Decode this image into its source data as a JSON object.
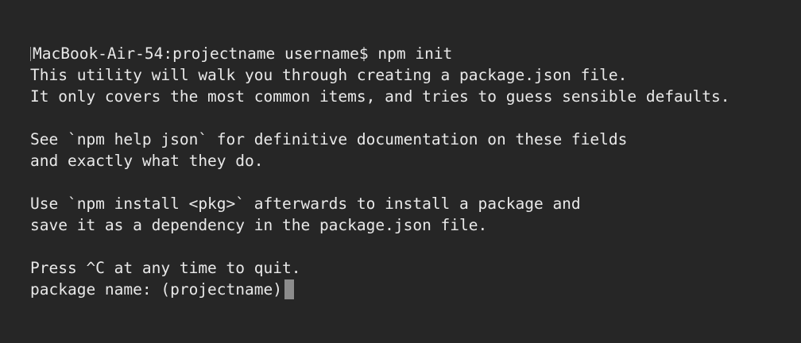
{
  "terminal": {
    "prompt_line": "MacBook-Air-54:projectname username$ npm init",
    "lines": [
      "This utility will walk you through creating a package.json file.",
      "It only covers the most common items, and tries to guess sensible defaults.",
      "",
      "See `npm help json` for definitive documentation on these fields",
      "and exactly what they do.",
      "",
      "Use `npm install <pkg>` afterwards to install a package and",
      "save it as a dependency in the package.json file.",
      "",
      "Press ^C at any time to quit."
    ],
    "input_prompt": "package name: (projectname)",
    "input_value": ""
  },
  "colors": {
    "background": "#262626",
    "text": "#e9e9e9",
    "cursor": "#8c8c8c"
  }
}
